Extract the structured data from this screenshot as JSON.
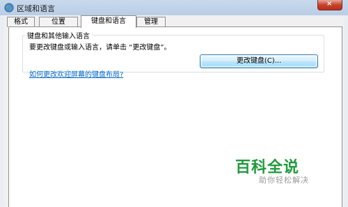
{
  "window": {
    "title": "区域和语言",
    "close_label": "×"
  },
  "tabs": [
    {
      "label": "格式",
      "active": false
    },
    {
      "label": "位置",
      "active": false
    },
    {
      "label": "键盘和语言",
      "active": true
    },
    {
      "label": "管理",
      "active": false
    }
  ],
  "keyboard_section": {
    "title": "键盘和其他输入语言",
    "description": "要更改键盘或输入语言，请单击 “更改键盘”。",
    "change_button": "更改键盘(C)...",
    "help_link": "如何更改欢迎屏幕的键盘布局?"
  },
  "watermark": {
    "title": "百科全说",
    "subtitle": "助你轻松解决"
  },
  "colors": {
    "link": "#0066cc",
    "watermark_green": "#1f9a3a"
  }
}
